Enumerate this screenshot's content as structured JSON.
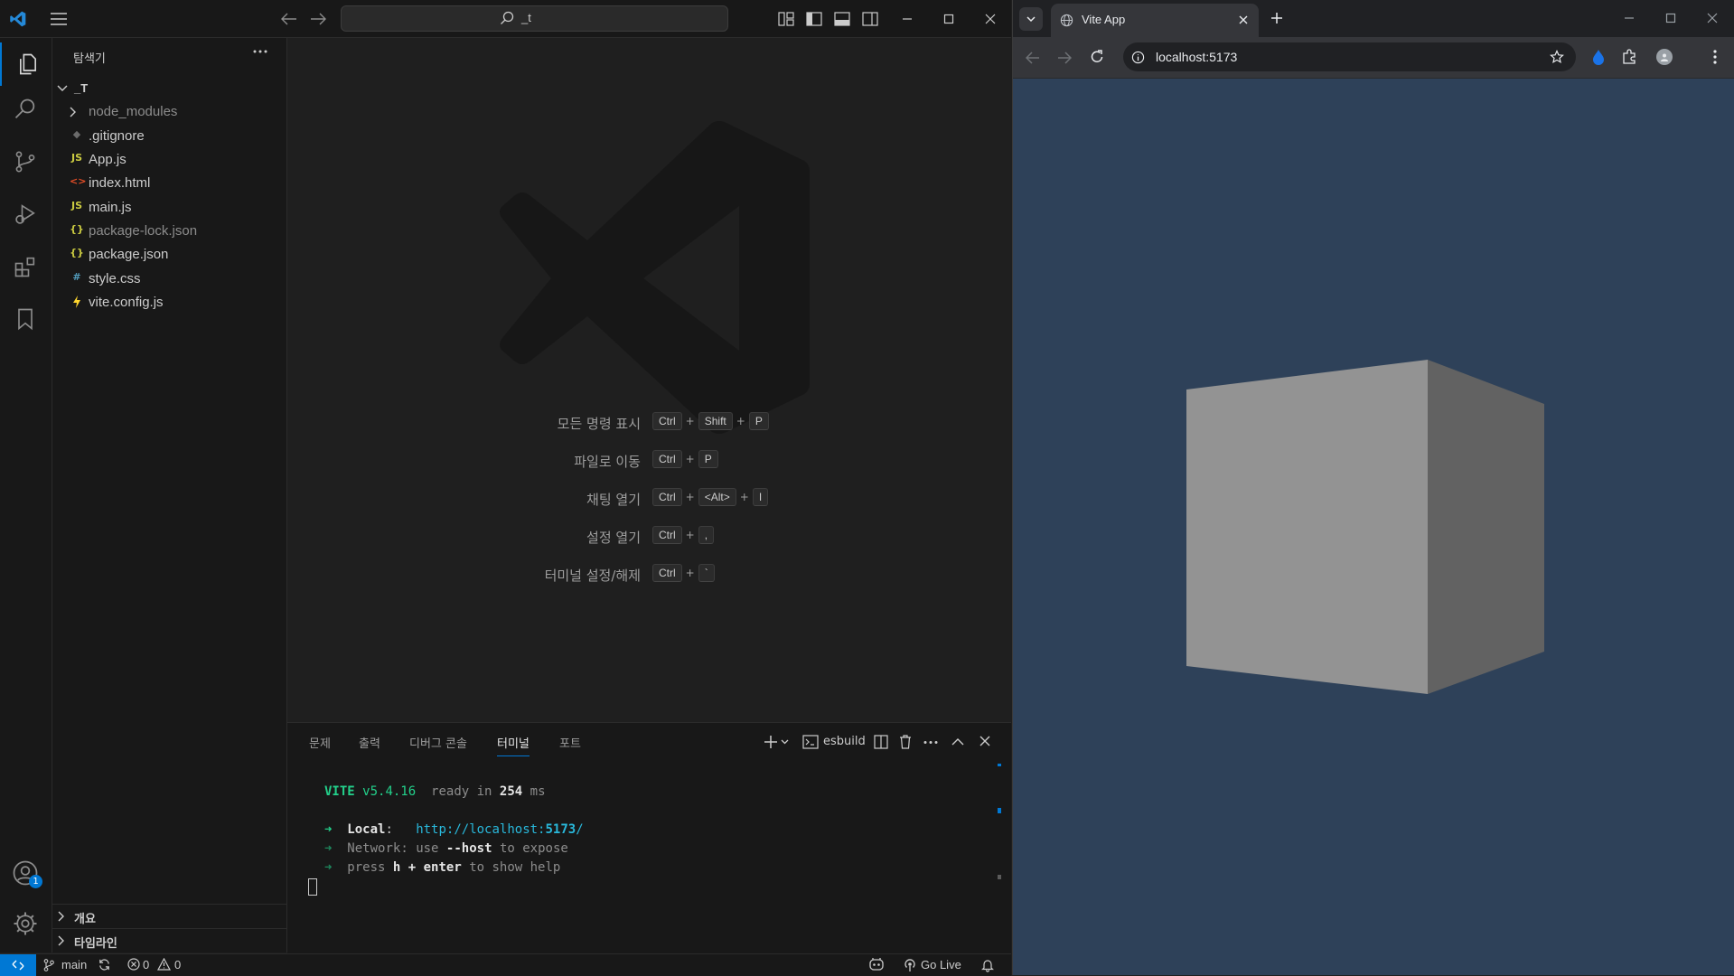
{
  "vscode": {
    "command_center": {
      "query": "_t"
    },
    "sidebar": {
      "title": "탐색기",
      "root_folder": "_T",
      "items": [
        {
          "label": "node_modules",
          "icon": "chevron-right-icon",
          "dim": true
        },
        {
          "label": ".gitignore",
          "icon": "git-icon",
          "dim": false
        },
        {
          "label": "App.js",
          "icon": "js-icon",
          "icon_text": "JS",
          "dim": false
        },
        {
          "label": "index.html",
          "icon": "html-icon",
          "icon_text": "<>",
          "dim": false
        },
        {
          "label": "main.js",
          "icon": "js-icon",
          "icon_text": "JS",
          "dim": false
        },
        {
          "label": "package-lock.json",
          "icon": "json-icon",
          "icon_text": "{}",
          "dim": true
        },
        {
          "label": "package.json",
          "icon": "json-icon",
          "icon_text": "{}",
          "dim": false
        },
        {
          "label": "style.css",
          "icon": "css-icon",
          "icon_text": "#",
          "dim": false
        },
        {
          "label": "vite.config.js",
          "icon": "vite-icon",
          "dim": false
        }
      ],
      "outline_label": "개요",
      "timeline_label": "타임라인"
    },
    "editor_hints": [
      {
        "label": "모든 명령 표시",
        "keys": [
          "Ctrl",
          "Shift",
          "P"
        ]
      },
      {
        "label": "파일로 이동",
        "keys": [
          "Ctrl",
          "P"
        ]
      },
      {
        "label": "채팅 열기",
        "keys": [
          "Ctrl",
          "<Alt>",
          "I"
        ]
      },
      {
        "label": "설정 열기",
        "keys": [
          "Ctrl",
          ","
        ]
      },
      {
        "label": "터미널 설정/해제",
        "keys": [
          "Ctrl",
          "`"
        ]
      }
    ],
    "panel": {
      "tabs": [
        "문제",
        "출력",
        "디버그 콘솔",
        "터미널",
        "포트"
      ],
      "active_tab": "터미널",
      "terminal_name": "esbuild",
      "terminal": {
        "vite": "VITE",
        "version": "v5.4.16",
        "ready_text": "ready in",
        "ready_ms": "254",
        "ms_unit": "ms",
        "arrow": "➜",
        "local_label": "Local",
        "local_url_base": "http://localhost:",
        "local_url_port": "5173",
        "local_url_slash": "/",
        "network_label": "Network",
        "network_text_1": "use",
        "network_flag": "--host",
        "network_text_2": "to expose",
        "help_text_1": "press",
        "help_keys": "h + enter",
        "help_text_2": "to show help",
        "colon": ":"
      }
    },
    "accounts_badge": "1",
    "statusbar": {
      "branch": "main",
      "errors": "0",
      "warnings": "0",
      "go_live": "Go Live"
    }
  },
  "chrome": {
    "tab_title": "Vite App",
    "url": "localhost:5173",
    "page_background": "#2e4159",
    "cube_colors": {
      "front": "#939393",
      "side": "#626262"
    }
  },
  "colors": {
    "accent": "#0078d4",
    "editor_bg": "#1f1f1f",
    "chrome_bg": "#181818"
  }
}
